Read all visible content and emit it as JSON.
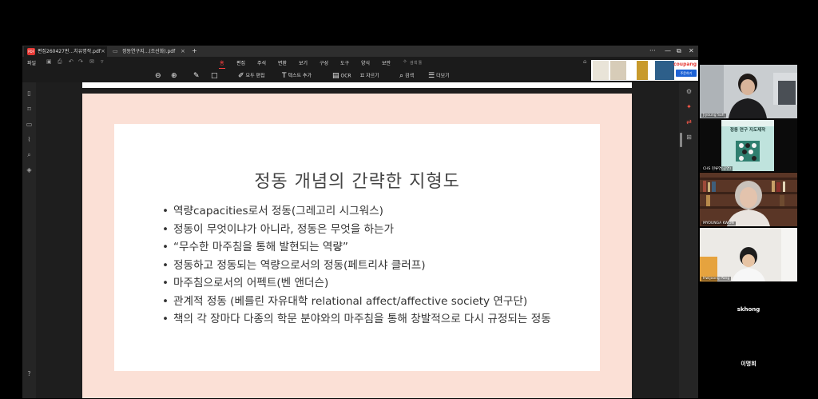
{
  "window": {
    "tabs": [
      {
        "label": "편집260427판...치유명작.pdf",
        "active": true
      },
      {
        "label": "정동연구지...(조선화).pdf",
        "active": false
      }
    ],
    "new_tab": "+",
    "controls": {
      "more": "···",
      "minimize": "—",
      "restore": "⧉",
      "close": "✕"
    }
  },
  "menubar": {
    "file": "파일",
    "items": [
      "홈",
      "편집",
      "주석",
      "변환",
      "보기",
      "구성",
      "도구",
      "양식",
      "보안"
    ],
    "active": "홈",
    "search_label": "검색 툴"
  },
  "toolbar": {
    "edit_all": "모두 편집",
    "add_text": "텍스트 추가",
    "ocr": "OCR",
    "crop": "자르기",
    "search": "검색",
    "more": "더보기"
  },
  "ads": {
    "brand": "coupang",
    "cta": "주문하기"
  },
  "slide": {
    "title": "정동 개념의 간략한 지형도",
    "bullets": [
      "역량capacities로서 정동(그레고리 시그워스)",
      "정동이 무엇이냐가 아니라, 정동은 무엇을 하는가",
      "“무수한 마주침을 통해 발현되는 역량”",
      "정동하고 정동되는 역량으로서의 정동(페트리샤 클러프)",
      "마주침으로서의 어펙트(벤 앤더슨)",
      "관계적 정동 (베를린 자유대학 relational affect/affective society 연구단)",
      "책의 각 장마다 다종의 학문 분야와의 마주침을 통해 창발적으로 다시 규정되는 정동"
    ]
  },
  "participants": [
    {
      "name": "Jiyoung Suh",
      "kind": "video"
    },
    {
      "name": "CHS 현류연(공연)",
      "kind": "video",
      "book_title": "정동 연구 지도제작"
    },
    {
      "name": "MYOUNGA KWON",
      "kind": "video"
    },
    {
      "name": "Hwijoong Pang",
      "kind": "video"
    },
    {
      "name": "skhong",
      "kind": "name-only"
    },
    {
      "name": "이명희",
      "kind": "name-only"
    }
  ],
  "colors": {
    "slide_background": "#fbe0d6",
    "accent": "#ff4040",
    "app_background": "#1b1b1b"
  }
}
